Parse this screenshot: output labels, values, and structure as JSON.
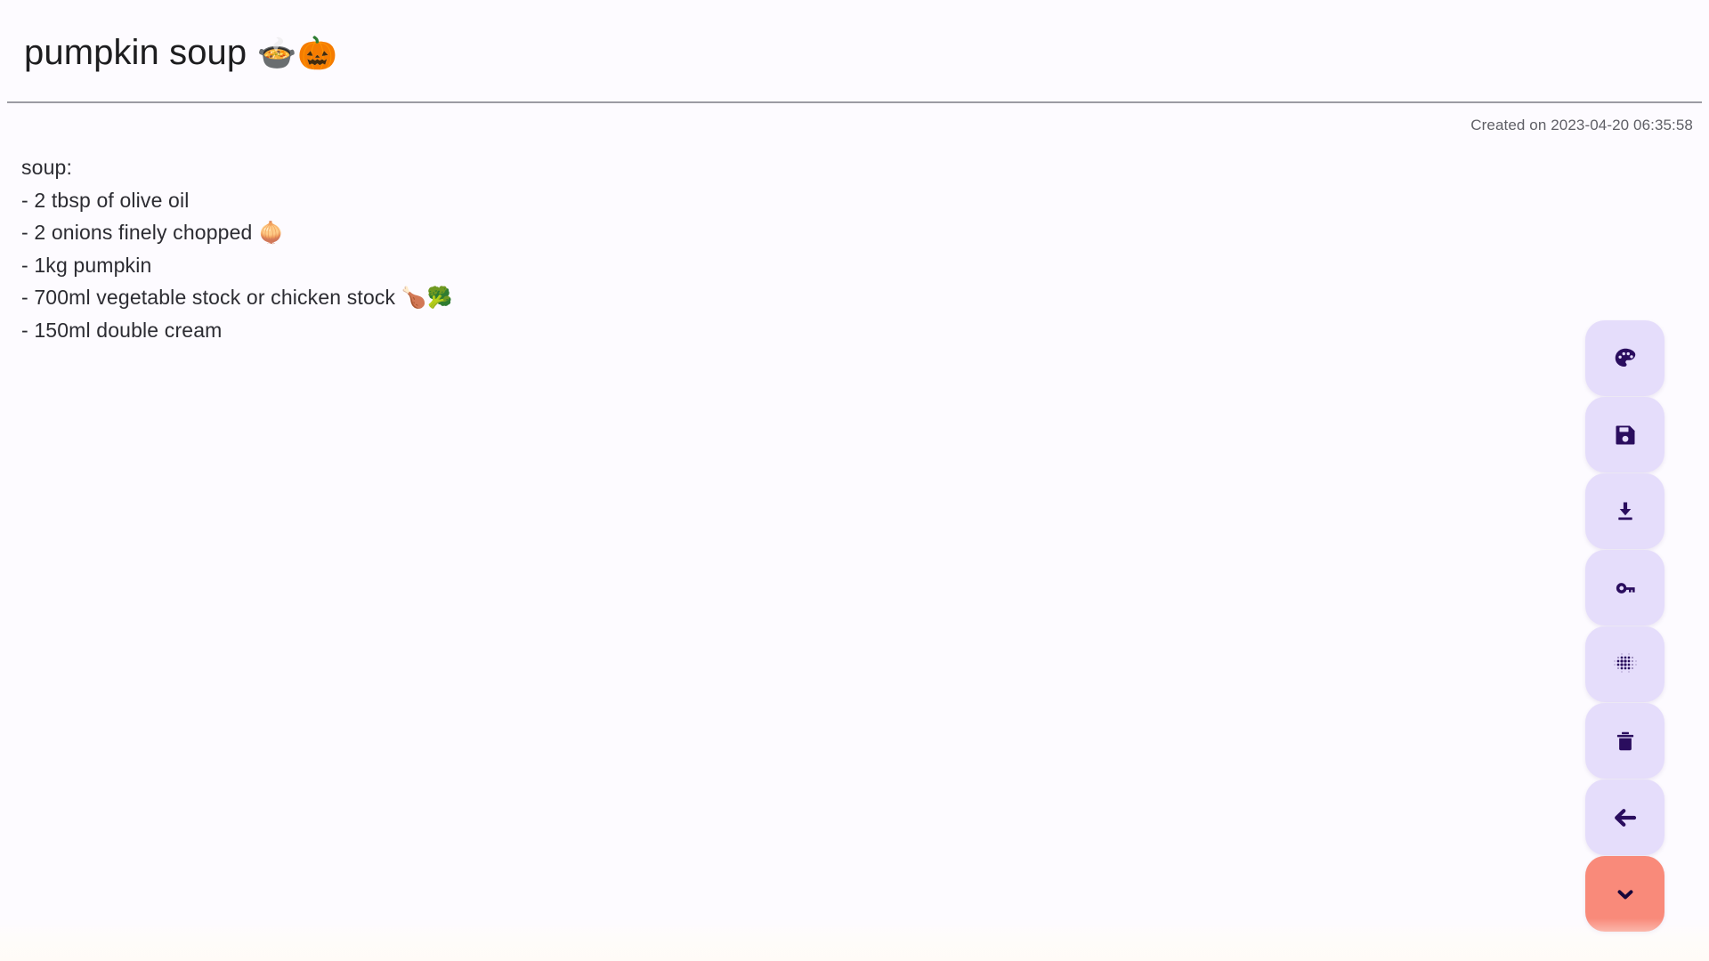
{
  "page": {
    "background_color": "#FDFBFF",
    "text_color": "#2c2c32"
  },
  "header": {
    "title": "pumpkin soup 🍲🎃",
    "title_text": "pumpkin soup",
    "title_emojis": "🍲🎃"
  },
  "meta": {
    "created_label": "Created on 2023-04-20 06:35:58",
    "created_prefix": "Created on",
    "created_timestamp": "2023-04-20 06:35:58"
  },
  "body": {
    "lines": [
      "soup:",
      "- 2 tbsp of olive oil",
      "- 2 onions finely chopped 🧅",
      "- 1kg pumpkin",
      "- 700ml vegetable stock or chicken stock 🍗🥦",
      "- 150ml double cream"
    ]
  },
  "actions": {
    "accent_color": "#2A0D5E",
    "button_color": "#E5DDFB",
    "danger_color": "#F98A7A",
    "buttons": [
      {
        "name": "palette-icon",
        "label": "Change theme color"
      },
      {
        "name": "save-icon",
        "label": "Save"
      },
      {
        "name": "download-icon",
        "label": "Download"
      },
      {
        "name": "key-icon",
        "label": "Password / encrypt"
      },
      {
        "name": "dot-grid-icon",
        "label": "Pattern / texture"
      },
      {
        "name": "trash-icon",
        "label": "Delete"
      },
      {
        "name": "back-arrow-icon",
        "label": "Back"
      },
      {
        "name": "chevron-down-icon",
        "label": "Collapse menu"
      }
    ]
  }
}
